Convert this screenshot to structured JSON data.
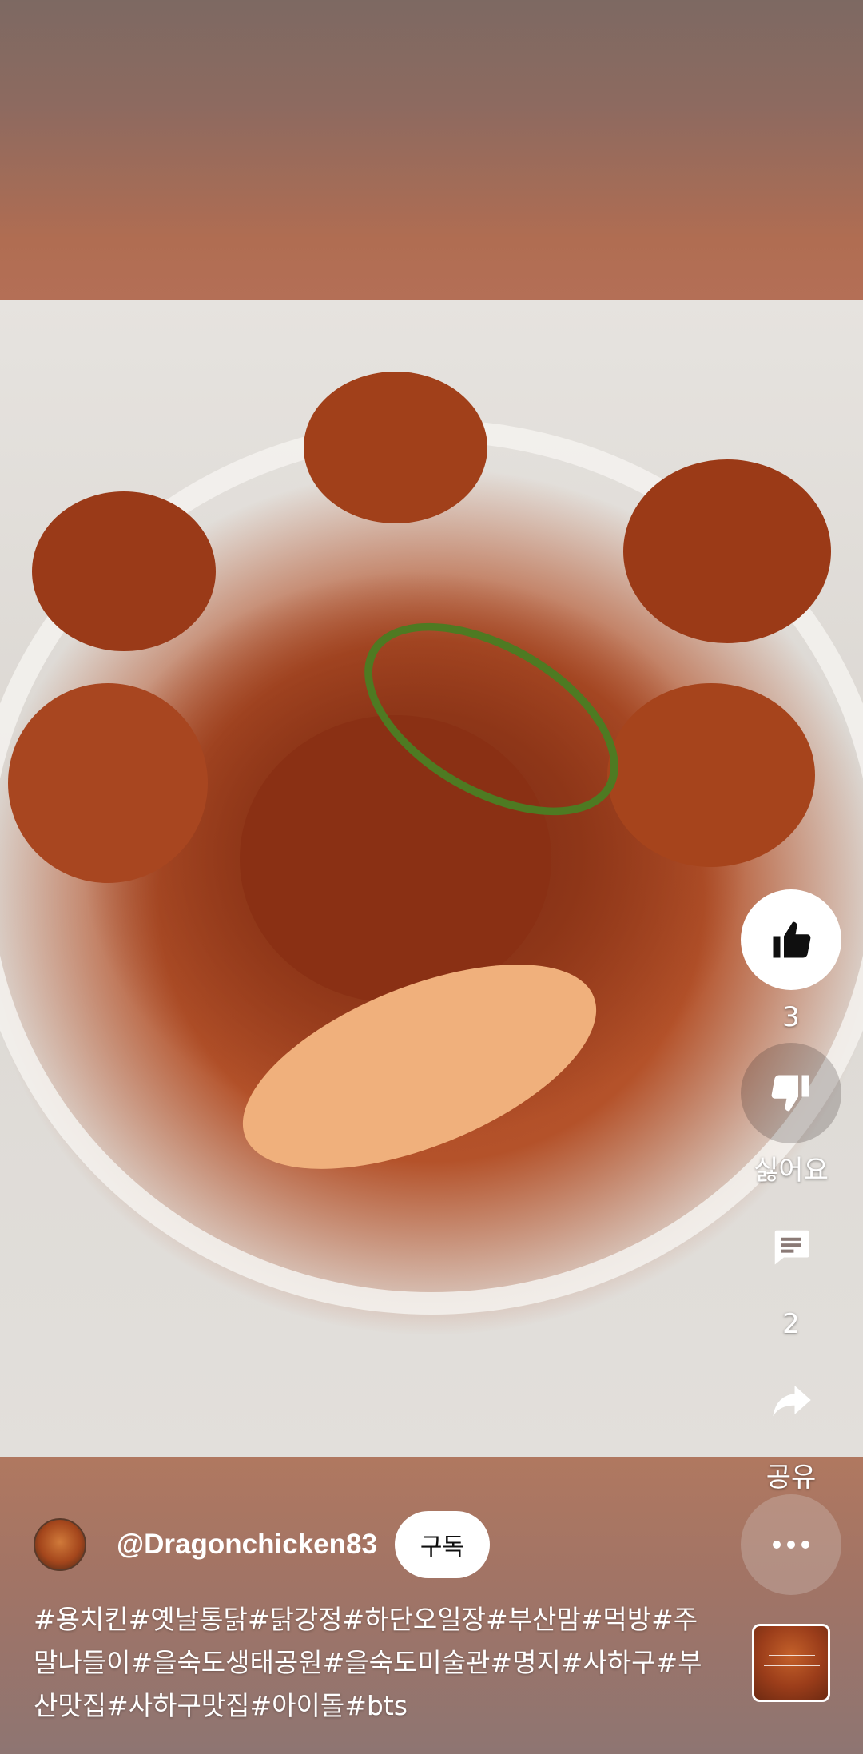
{
  "actions": {
    "like_count": "3",
    "dislike_label": "싫어요",
    "comment_count": "2",
    "share_label": "공유"
  },
  "channel": {
    "handle": "@Dragonchicken83",
    "subscribe_label": "구독"
  },
  "description": "#용치킨#옛날통닭#닭강정#하단오일장#부산맘#먹방#주말나들이#을숙도생태공원#을숙도미술관#명지#사하구#부산맛집#사하구맛집#아이돌#bts",
  "icons": {
    "like": "thumbs-up-icon",
    "dislike": "thumbs-down-icon",
    "comment": "comment-icon",
    "share": "share-icon",
    "more": "more-horizontal-icon"
  },
  "colors": {
    "button_bg": "#ffffff",
    "button_text": "#0f0f0f",
    "overlay_text": "#ffffff"
  }
}
